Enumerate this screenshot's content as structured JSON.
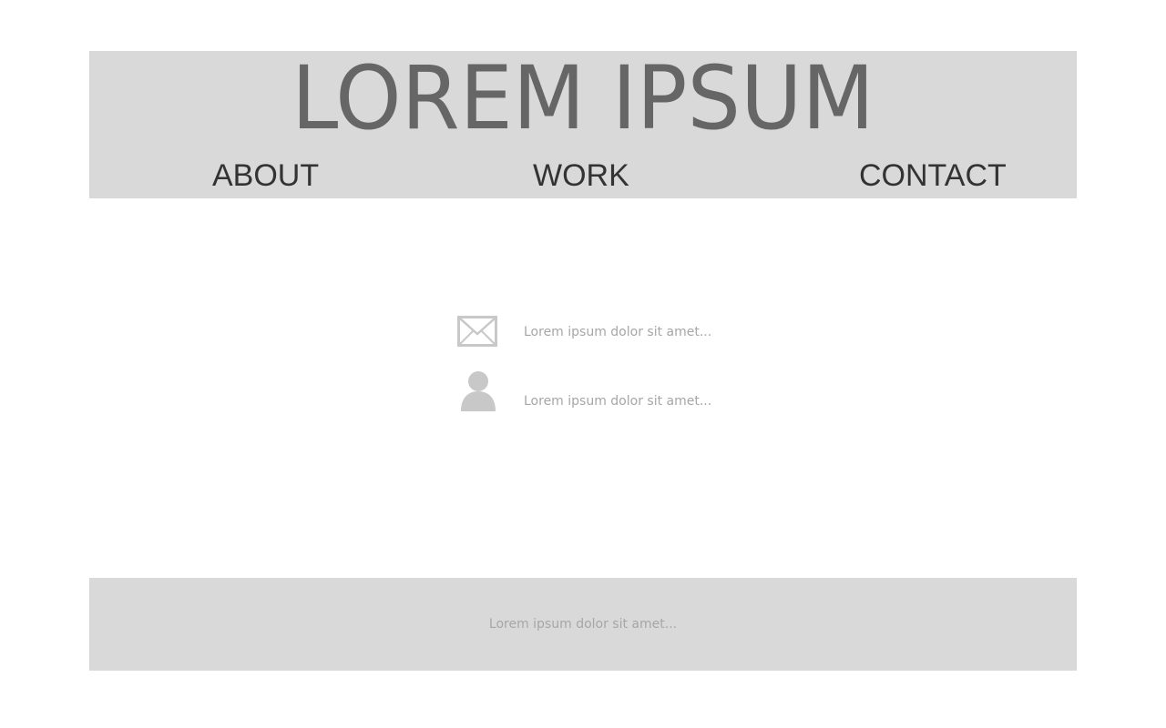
{
  "header": {
    "title": "LOREM IPSUM",
    "nav": [
      {
        "label": "ABOUT"
      },
      {
        "label": "WORK"
      },
      {
        "label": "CONTACT"
      }
    ]
  },
  "contact": {
    "items": [
      {
        "icon": "envelope-icon",
        "text": "Lorem ipsum dolor sit amet..."
      },
      {
        "icon": "person-icon",
        "text": "Lorem ipsum dolor sit amet..."
      }
    ]
  },
  "footer": {
    "text": "Lorem ipsum dolor sit amet..."
  },
  "colors": {
    "band_background": "#d9d9d9",
    "title_text": "#666666",
    "nav_text": "#333333",
    "muted_text": "#a6a6a6",
    "icon_fill": "#c8c8c8"
  }
}
